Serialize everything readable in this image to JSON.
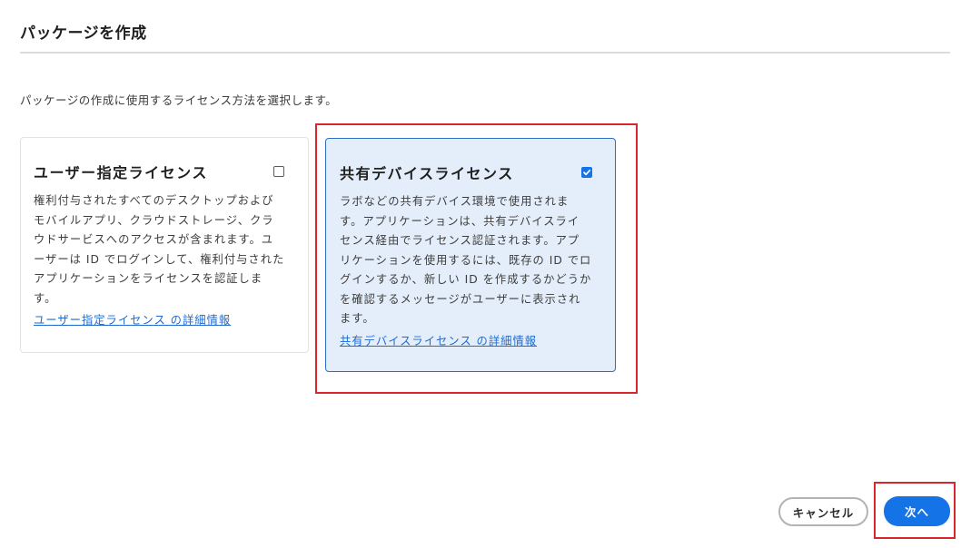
{
  "dialog": {
    "title": "パッケージを作成",
    "intro": "パッケージの作成に使用するライセンス方法を選択します。"
  },
  "options": [
    {
      "title": "ユーザー指定ライセンス",
      "checked": false,
      "lines": [
        "権利付与されたすべてのデスクトップおよび",
        "モバイルアプリ、クラウドストレージ、クラ",
        "ウドサービスへのアクセスが含まれます。ユ",
        "ーザーは ID でログインして、権利付与された",
        "アプリケーションをライセンスを認証しま",
        "す。"
      ],
      "link": "ユーザー指定ライセンス の詳細情報"
    },
    {
      "title": "共有デバイスライセンス",
      "checked": true,
      "lines": [
        "ラボなどの共有デバイス環境で使用されま",
        "す。アプリケーションは、共有デバイスライ",
        "センス経由でライセンス認証されます。アプ",
        "リケーションを使用するには、既存の ID でロ",
        "グインするか、新しい ID を作成するかどうか",
        "を確認するメッセージがユーザーに表示され",
        "ます。"
      ],
      "link": "共有デバイスライセンス の詳細情報"
    }
  ],
  "footer": {
    "cancel_label": "キャンセル",
    "next_label": "次へ"
  },
  "colors": {
    "accent": "#1473e6",
    "selected_card_bg": "#e4eefb",
    "highlight": "#d9262c"
  }
}
